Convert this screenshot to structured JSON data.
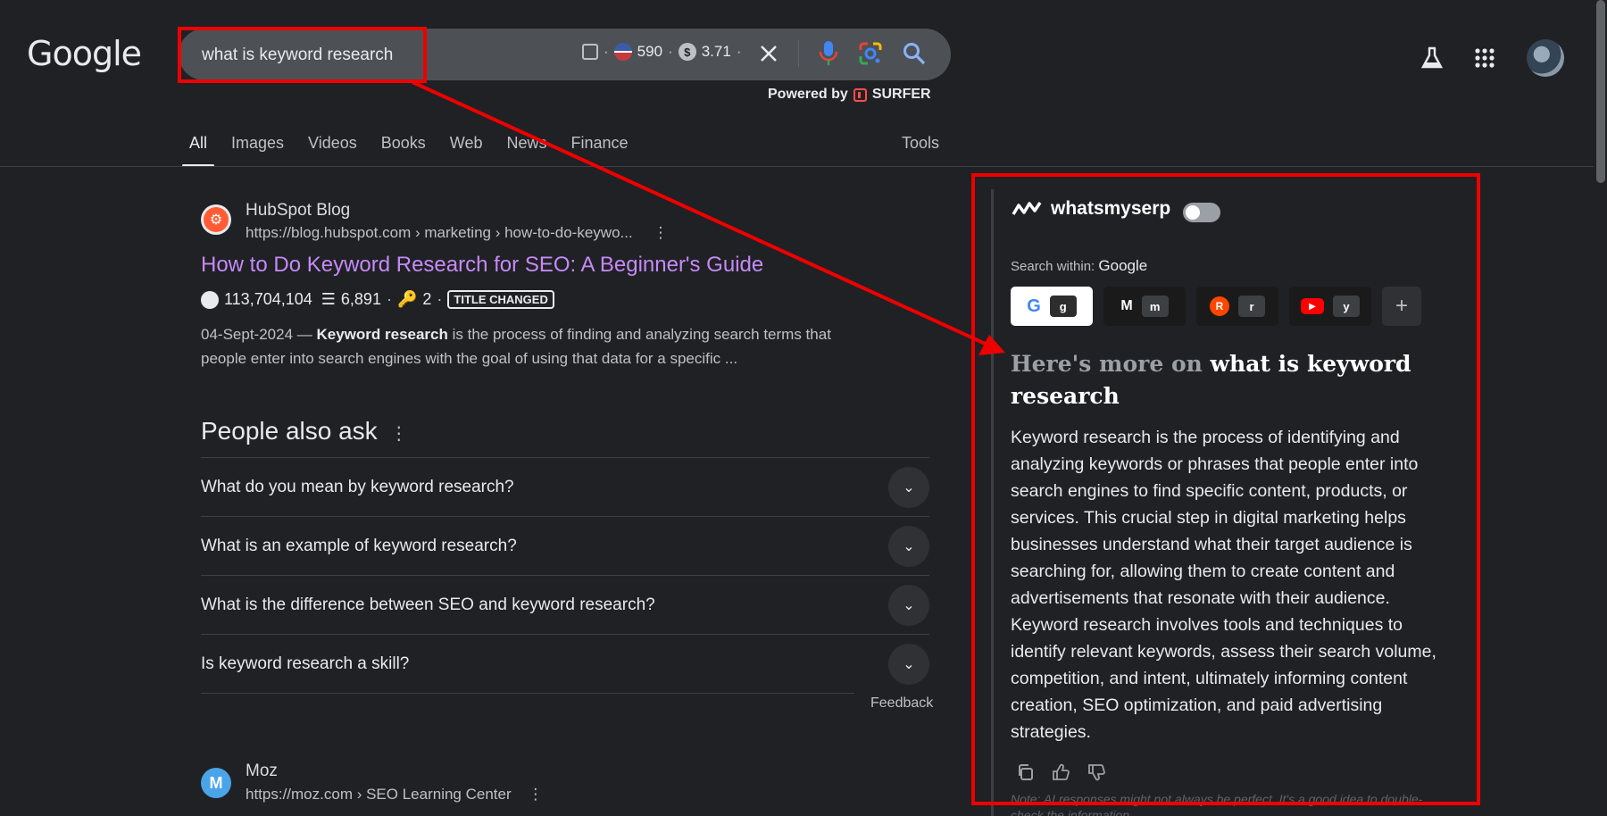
{
  "header": {
    "logo": "Google",
    "query": "what is keyword research",
    "metric_volume": "590",
    "metric_cpc": "3.71",
    "dollar_glyph": "$",
    "powered_by": "Powered by",
    "surfer": "SURFER"
  },
  "tabs": [
    "All",
    "Images",
    "Videos",
    "Books",
    "Web",
    "News",
    "Finance"
  ],
  "tools": "Tools",
  "result": {
    "site": "HubSpot Blog",
    "url": "https://blog.hubspot.com › marketing › how-to-do-keywo...",
    "title": "How to Do Keyword Research for SEO: A Beginner's Guide",
    "traffic": "113,704,104",
    "words": "6,891",
    "links": "2",
    "badge": "TITLE CHANGED",
    "date": "04-Sept-2024 —",
    "snippet_bold": "Keyword research",
    "snippet_rest": "is the process of finding and analyzing search terms that people enter into search engines with the goal of using that data for a specific ..."
  },
  "paa": {
    "title": "People also ask",
    "questions": [
      "What do you mean by keyword research?",
      "What is an example of keyword research?",
      "What is the difference between SEO and keyword research?",
      "Is keyword research a skill?"
    ],
    "feedback": "Feedback"
  },
  "moz": {
    "site": "Moz",
    "url": "https://moz.com › SEO Learning Center",
    "letter": "M"
  },
  "panel": {
    "brand": "whatsmyserp",
    "search_within_label": "Search within:",
    "search_within_value": "Google",
    "engines": [
      {
        "icon": "G",
        "key": "g"
      },
      {
        "icon": "M",
        "key": "m"
      },
      {
        "icon": "R",
        "key": "r"
      },
      {
        "icon": "▶",
        "key": "y"
      }
    ],
    "plus": "+",
    "more_prefix": "Here's more on",
    "more_query": "what is keyword research",
    "answer": "Keyword research is the process of identifying and analyzing keywords or phrases that people enter into search engines to find specific content, products, or services. This crucial step in digital marketing helps businesses understand what their target audience is searching for, allowing them to create content and advertisements that resonate with their audience. Keyword research involves tools and techniques to identify relevant keywords, assess their search volume, competition, and intent, ultimately informing content creation, SEO optimization, and paid advertising strategies.",
    "note": "Note: AI responses might not always be perfect. It's a good idea to double-check the information."
  },
  "colors": {
    "link": "#c58af9",
    "annotation": "#ee0000",
    "bg": "#202124"
  }
}
